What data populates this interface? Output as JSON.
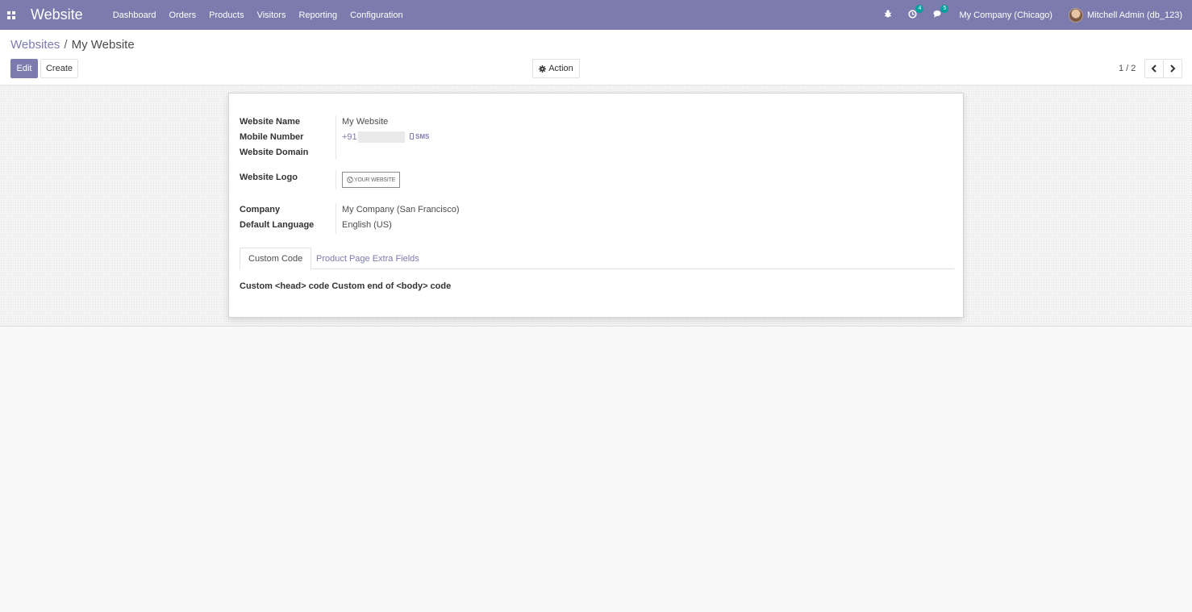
{
  "navbar": {
    "brand": "Website",
    "menu": [
      "Dashboard",
      "Orders",
      "Products",
      "Visitors",
      "Reporting",
      "Configuration"
    ],
    "activity_count": "4",
    "messages_count": "5",
    "company": "My Company (Chicago)",
    "user": "Mitchell Admin (db_123)"
  },
  "breadcrumb": {
    "parent": "Websites",
    "separator": "/",
    "current": "My Website"
  },
  "toolbar": {
    "edit": "Edit",
    "create": "Create",
    "action": "Action"
  },
  "pager": {
    "value": "1 / 2"
  },
  "form": {
    "website_name_label": "Website Name",
    "website_name": "My Website",
    "mobile_label": "Mobile Number",
    "mobile_prefix": "+91",
    "sms_label": "SMS",
    "domain_label": "Website Domain",
    "logo_label": "Website Logo",
    "logo_text": "YOUR WEBSITE",
    "company_label": "Company",
    "company": "My Company (San Francisco)",
    "language_label": "Default Language",
    "language": "English (US)"
  },
  "tabs": {
    "custom_code": "Custom Code",
    "product_page": "Product Page Extra Fields"
  },
  "custom_code": {
    "head": "Custom <head> code",
    "body": "Custom end of <body> code"
  },
  "colors": {
    "brand": "#7c7bad",
    "badge": "#00a09d"
  }
}
